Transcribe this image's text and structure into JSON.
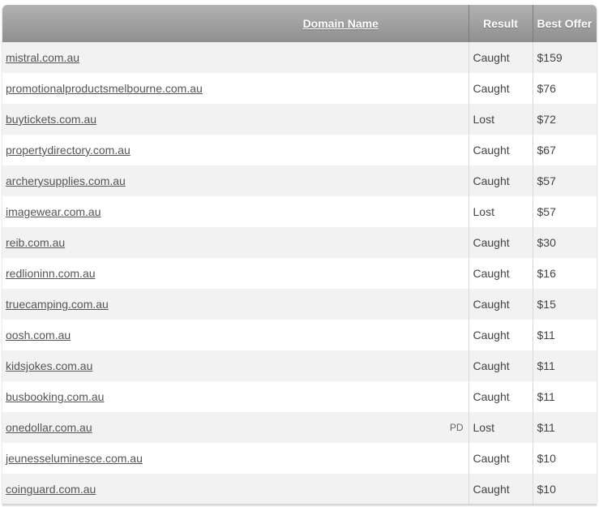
{
  "table": {
    "headers": {
      "domain": "Domain Name",
      "result": "Result",
      "offer": "Best Offer"
    },
    "rows": [
      {
        "domain": "mistral.com.au",
        "tag": "",
        "result": "Caught",
        "offer": "$159"
      },
      {
        "domain": "promotionalproductsmelbourne.com.au",
        "tag": "",
        "result": "Caught",
        "offer": "$76"
      },
      {
        "domain": "buytickets.com.au",
        "tag": "",
        "result": "Lost",
        "offer": "$72"
      },
      {
        "domain": "propertydirectory.com.au",
        "tag": "",
        "result": "Caught",
        "offer": "$67"
      },
      {
        "domain": "archerysupplies.com.au",
        "tag": "",
        "result": "Caught",
        "offer": "$57"
      },
      {
        "domain": "imagewear.com.au",
        "tag": "",
        "result": "Lost",
        "offer": "$57"
      },
      {
        "domain": "reib.com.au",
        "tag": "",
        "result": "Caught",
        "offer": "$30"
      },
      {
        "domain": "redlioninn.com.au",
        "tag": "",
        "result": "Caught",
        "offer": "$16"
      },
      {
        "domain": "truecamping.com.au",
        "tag": "",
        "result": "Caught",
        "offer": "$15"
      },
      {
        "domain": "oosh.com.au",
        "tag": "",
        "result": "Caught",
        "offer": "$11"
      },
      {
        "domain": "kidsjokes.com.au",
        "tag": "",
        "result": "Caught",
        "offer": "$11"
      },
      {
        "domain": "busbooking.com.au",
        "tag": "",
        "result": "Caught",
        "offer": "$11"
      },
      {
        "domain": "onedollar.com.au",
        "tag": "PD",
        "result": "Lost",
        "offer": "$11"
      },
      {
        "domain": "jeunesseluminesce.com.au",
        "tag": "",
        "result": "Caught",
        "offer": "$10"
      },
      {
        "domain": "coinguard.com.au",
        "tag": "",
        "result": "Caught",
        "offer": "$10"
      }
    ]
  }
}
